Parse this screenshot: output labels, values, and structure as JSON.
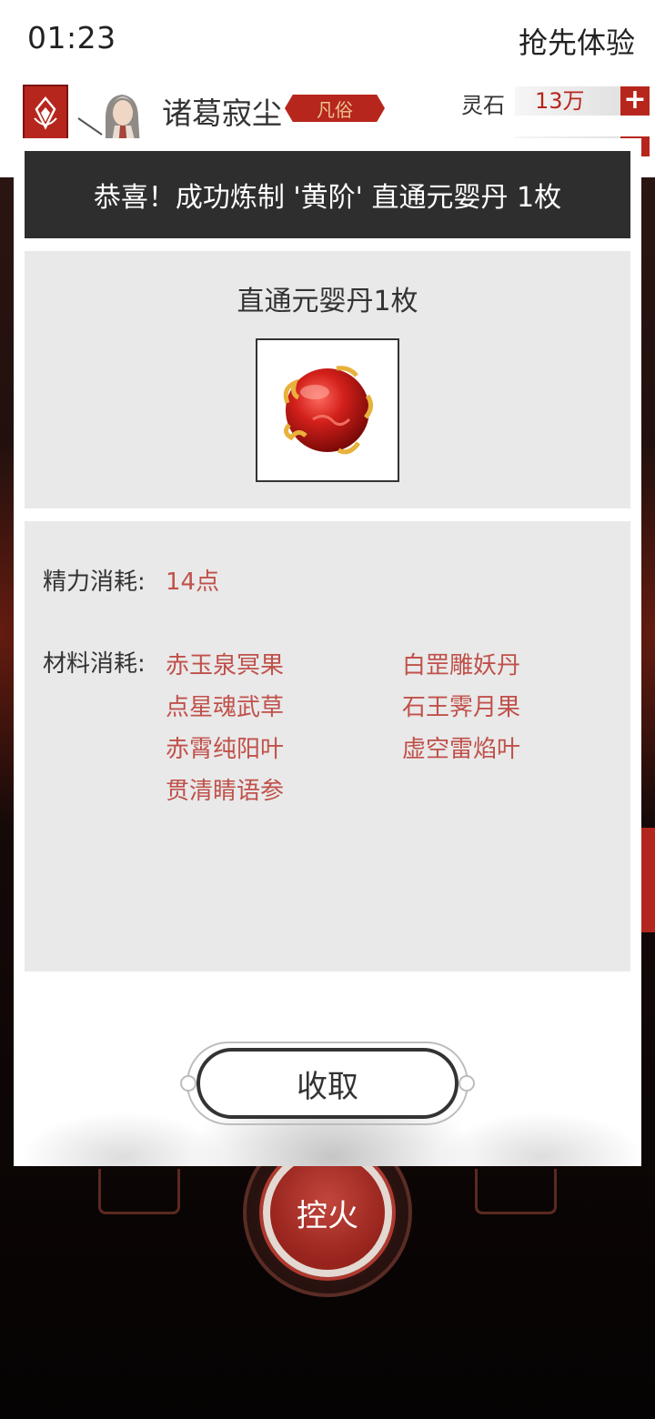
{
  "status_bar": {
    "time": "01:23",
    "right_text": "抢先体验"
  },
  "header": {
    "player_name": "诸葛寂尘",
    "rank": "凡俗",
    "spirit_stone_label": "灵石",
    "spirit_stone_value": "13万"
  },
  "dialog": {
    "title": "恭喜！成功炼制 '黄阶' 直通元婴丹 1枚",
    "result_item": "直通元婴丹1枚",
    "energy_label": "精力消耗:",
    "energy_value": "14点",
    "materials_label": "材料消耗:",
    "materials": [
      "赤玉泉冥果",
      "白罡雕妖丹",
      "点星魂武草",
      "石王霁月果",
      "赤霄纯阳叶",
      "虚空雷焰叶",
      "贯清睛语参"
    ],
    "collect_button": "收取"
  },
  "scene": {
    "fire_button": "控火"
  },
  "colors": {
    "accent_red": "#b7261d",
    "cost_text": "#c0514a",
    "title_bar": "#2e2e2e",
    "panel_gray": "#e9e9e9"
  }
}
